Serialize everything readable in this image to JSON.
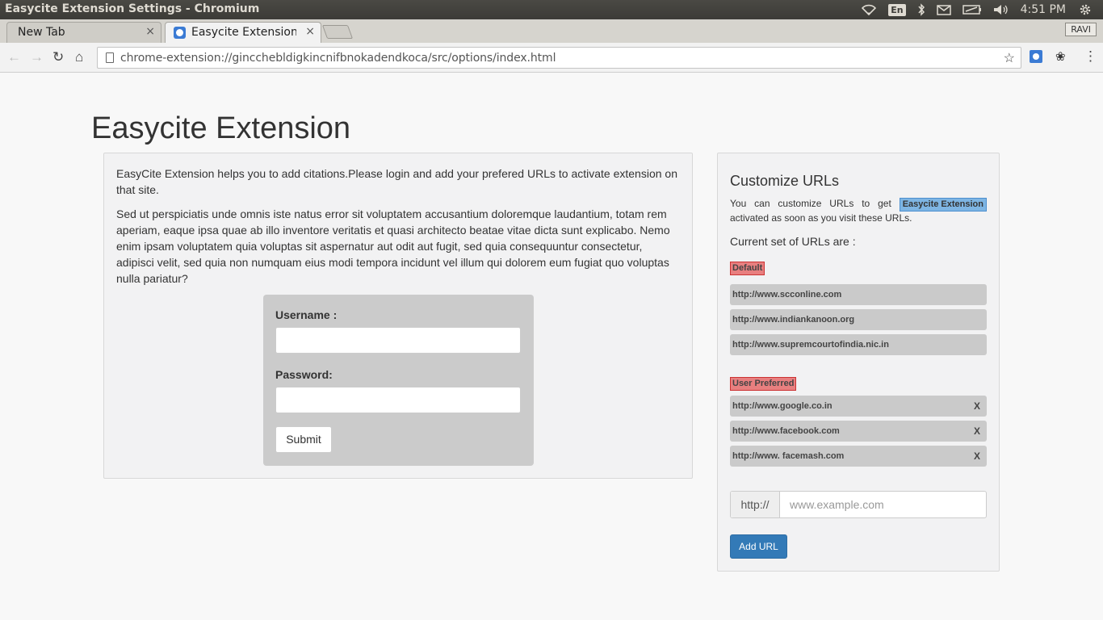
{
  "os": {
    "window_title": "Easycite Extension Settings - Chromium",
    "keyboard_layout": "En",
    "clock": "4:51 PM"
  },
  "browser": {
    "tabs": [
      {
        "label": "New Tab",
        "close": "×"
      },
      {
        "label": "Easycite Extension",
        "close": "×"
      }
    ],
    "profile": "RAVI",
    "url": "chrome-extension://gincchebldigkincnifbnokadendkoca/src/options/index.html"
  },
  "page": {
    "title": "Easycite Extension",
    "intro": "EasyCite Extension helps you to add citations.Please login and add your prefered URLs to activate extension on that site.",
    "lorem": "Sed ut perspiciatis unde omnis iste natus error sit voluptatem accusantium doloremque laudantium, totam rem aperiam, eaque ipsa quae ab illo inventore veritatis et quasi architecto beatae vitae dicta sunt explicabo. Nemo enim ipsam voluptatem quia voluptas sit aspernatur aut odit aut fugit, sed quia consequuntur consectetur, adipisci velit, sed quia non numquam eius modi tempora incidunt vel illum qui dolorem eum fugiat quo voluptas nulla pariatur?",
    "login": {
      "username_label": "Username :",
      "username_value": "",
      "password_label": "Password:",
      "password_value": "",
      "submit_label": "Submit"
    }
  },
  "customize": {
    "heading": "Customize URLs",
    "desc_before": "You can customize URLs to get",
    "desc_tag": "Easycite Extension",
    "desc_after": "activated as soon as you visit these URLs.",
    "current_label": "Current set of URLs are :",
    "default_tag": "Default",
    "default_urls": [
      "http://www.scconline.com",
      "http://www.indiankanoon.org",
      "http://www.supremcourtofindia.nic.in"
    ],
    "user_tag": "User Preferred",
    "user_urls": [
      {
        "url": "http://www.google.co.in",
        "remove": "X"
      },
      {
        "url": "http://www.facebook.com",
        "remove": "X"
      },
      {
        "url": "http://www. facemash.com",
        "remove": "X"
      }
    ],
    "prefix": "http://",
    "placeholder": "www.example.com",
    "add_button": "Add URL"
  },
  "colors": {
    "primary_button": "#337ab7",
    "tag_red": "#e87f7f",
    "tag_blue": "#7eb5e3"
  }
}
